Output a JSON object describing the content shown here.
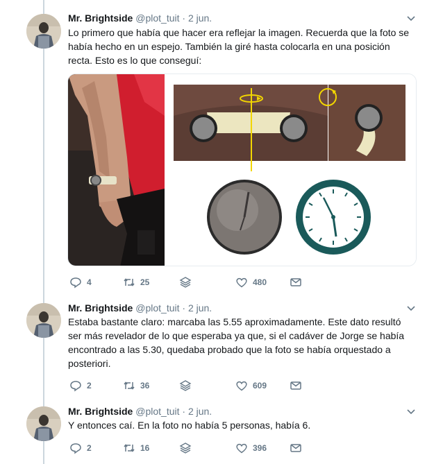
{
  "tweets": [
    {
      "author": "Mr. Brightside",
      "handle": "@plot_tuit",
      "separator": "·",
      "date": "2 jun.",
      "text": "Lo primero que había que hacer era reflejar la imagen. Recuerda que la foto se había hecho en un espejo. También la giré hasta colocarla en una posición recta. Esto es lo que conseguí:",
      "replies": "4",
      "retweets": "25",
      "likes": "480"
    },
    {
      "author": "Mr. Brightside",
      "handle": "@plot_tuit",
      "separator": "·",
      "date": "2 jun.",
      "text": "Estaba bastante claro: marcaba las 5.55 aproximadamente. Este dato resultó ser más revelador de lo que esperaba ya que, si el cadáver de Jorge se había encontrado a las 5.30, quedaba probado que la foto se había orquestado a posteriori.",
      "replies": "2",
      "retweets": "36",
      "likes": "609"
    },
    {
      "author": "Mr. Brightside",
      "handle": "@plot_tuit",
      "separator": "·",
      "date": "2 jun.",
      "text": "Y entonces caí. En la foto no había 5 personas, había 6.",
      "replies": "2",
      "retweets": "16",
      "likes": "396"
    }
  ],
  "icons": {
    "reply": "reply-icon",
    "retweet": "retweet-icon",
    "stack": "stack-icon",
    "like": "heart-icon",
    "message": "envelope-icon",
    "caret": "chevron-down-icon"
  },
  "colors": {
    "text": "#14171a",
    "muted": "#657786",
    "border": "#e6ecf0",
    "clock_teal": "#1a5a5a",
    "marker_yellow": "#f2d600"
  }
}
